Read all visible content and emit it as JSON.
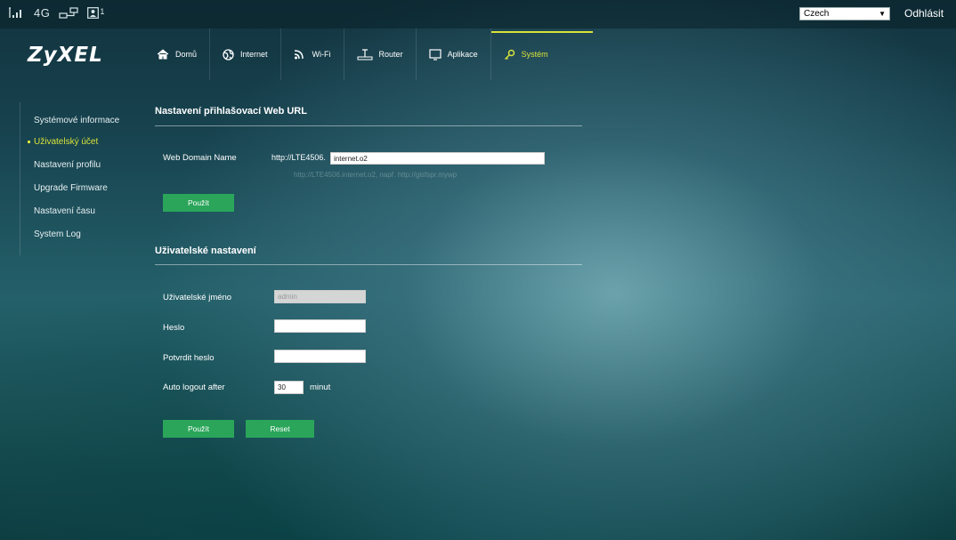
{
  "status": {
    "network": "4G",
    "badge": "1"
  },
  "header": {
    "language": "Czech",
    "logout": "Odhlásit"
  },
  "brand": {
    "logo": "ZyXEL"
  },
  "nav": {
    "home": "Domů",
    "internet": "Internet",
    "wifi": "Wi-Fi",
    "router": "Router",
    "apps": "Aplikace",
    "system": "Systém",
    "active": "system",
    "accent_color": "#d8e23a"
  },
  "sidebar": {
    "items": [
      {
        "label": "Systémové informace"
      },
      {
        "label": "Uživatelský účet",
        "active": true
      },
      {
        "label": "Nastavení profilu"
      },
      {
        "label": "Upgrade Firmware"
      },
      {
        "label": "Nastavení času"
      },
      {
        "label": "System Log"
      }
    ]
  },
  "web_url": {
    "title": "Nastavení přihlašovací Web URL",
    "domain_label": "Web Domain Name",
    "prefix": "http://LTE4506.",
    "domain_value": "internet.o2",
    "hint": "http://LTE4506.internet.o2, např. http://gisfspr.mywp",
    "apply": "Použít"
  },
  "user_settings": {
    "title": "Uživatelské nastavení",
    "username_label": "Uživatelské jméno",
    "username_value": "admin",
    "password_label": "Heslo",
    "password_value": "",
    "confirm_label": "Potvrdit heslo",
    "confirm_value": "",
    "autologout_label": "Auto logout after",
    "autologout_value": "30",
    "autologout_unit": "minut",
    "apply": "Použít",
    "reset": "Reset",
    "button_color": "#2aa55a"
  }
}
